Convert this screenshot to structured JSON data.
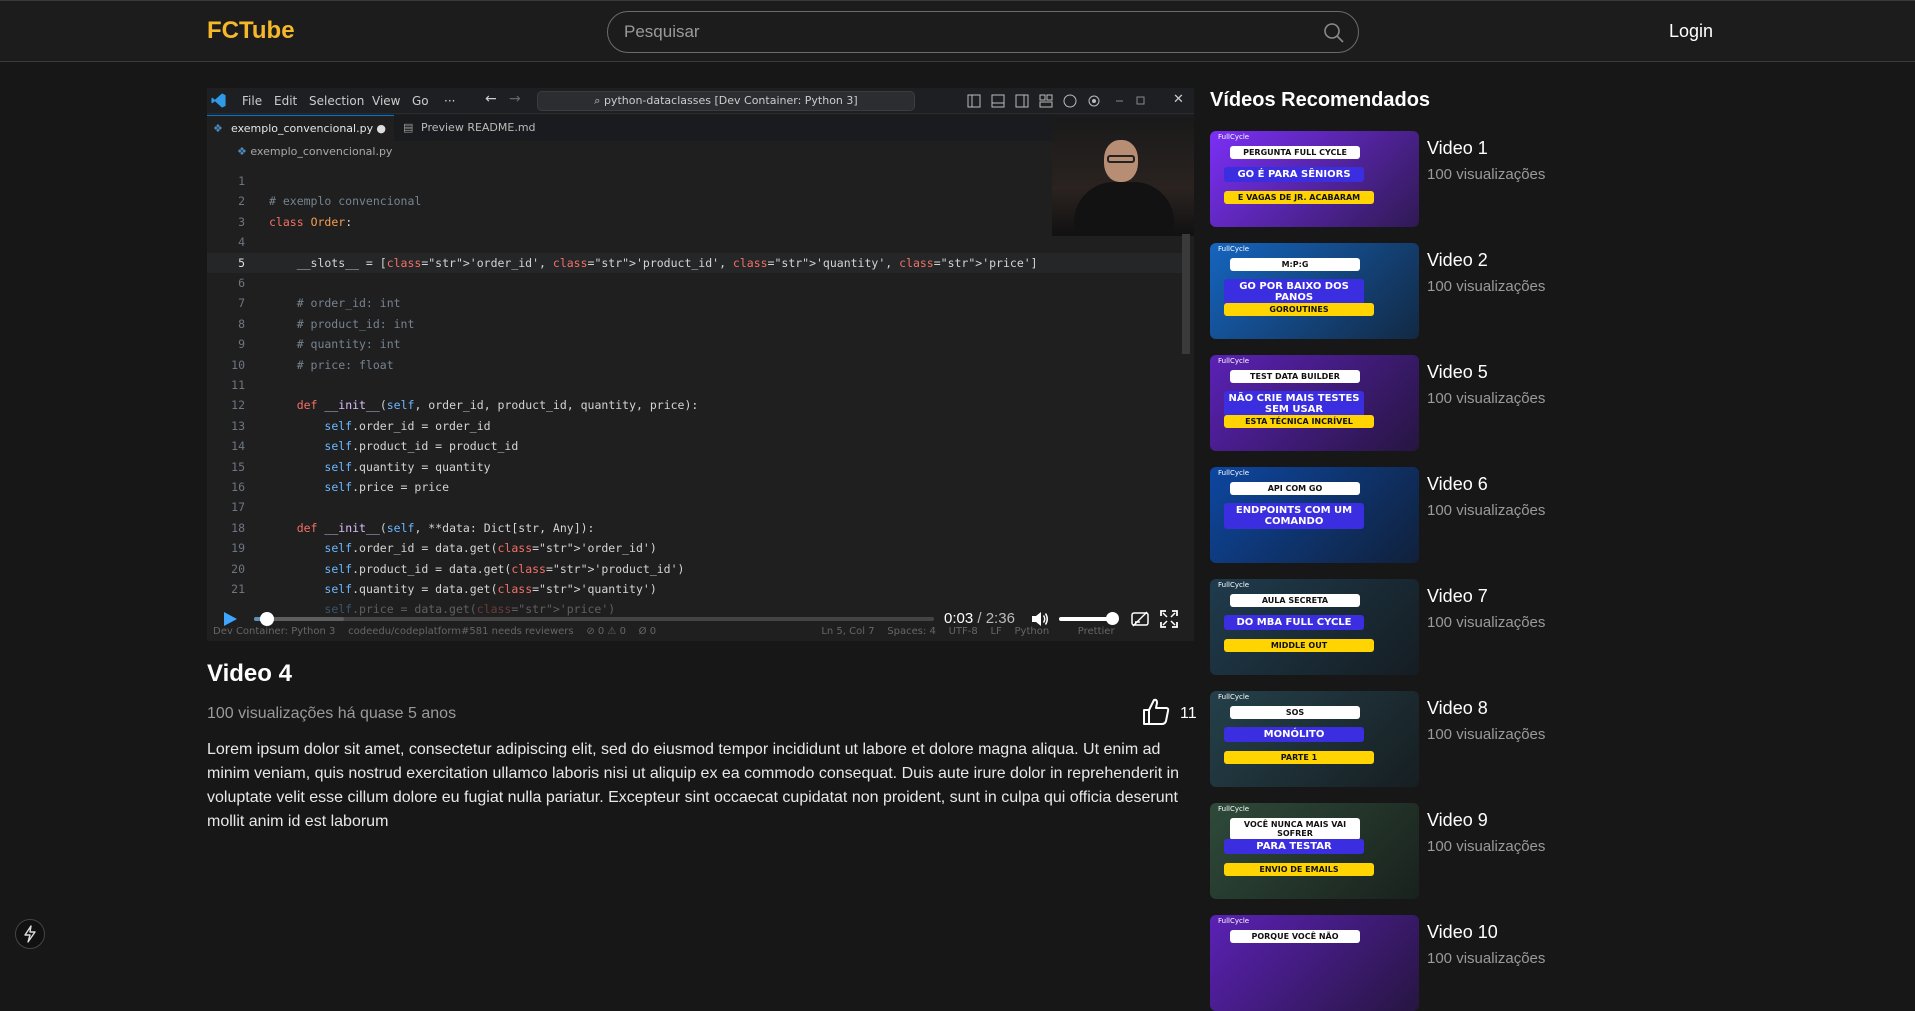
{
  "header": {
    "logo": "FCTube",
    "search_placeholder": "Pesquisar",
    "login_label": "Login",
    "accent_color": "#f5b72b"
  },
  "player": {
    "editor": {
      "menu": [
        "File",
        "Edit",
        "Selection",
        "View",
        "Go",
        "···"
      ],
      "command_center": "python-dataclasses [Dev Container: Python 3]",
      "tabs": [
        "exemplo_convencional.py",
        "Preview README.md"
      ],
      "breadcrumb": "exemplo_convencional.py",
      "status_bar": "Dev Container: Python 3    codeedu/codeplatform#581 needs reviewers    ⊘ 0 ⚠ 0    Ø 0                                                    Ln 5, Col 7    Spaces: 4    UTF-8    LF    Python         Prettier",
      "lines": [
        {
          "n": "1",
          "code": ""
        },
        {
          "n": "2",
          "code": "# exemplo convencional"
        },
        {
          "n": "3",
          "code": "class Order:"
        },
        {
          "n": "4",
          "code": ""
        },
        {
          "n": "5",
          "code": "    __slots__ = ['order_id', 'product_id', 'quantity', 'price']"
        },
        {
          "n": "6",
          "code": ""
        },
        {
          "n": "7",
          "code": "    # order_id: int"
        },
        {
          "n": "8",
          "code": "    # product_id: int"
        },
        {
          "n": "9",
          "code": "    # quantity: int"
        },
        {
          "n": "10",
          "code": "    # price: float"
        },
        {
          "n": "11",
          "code": ""
        },
        {
          "n": "12",
          "code": "    def __init__(self, order_id, product_id, quantity, price):"
        },
        {
          "n": "13",
          "code": "        self.order_id = order_id"
        },
        {
          "n": "14",
          "code": "        self.product_id = product_id"
        },
        {
          "n": "15",
          "code": "        self.quantity = quantity"
        },
        {
          "n": "16",
          "code": "        self.price = price"
        },
        {
          "n": "17",
          "code": ""
        },
        {
          "n": "18",
          "code": "    def __init__(self, **data: Dict[str, Any]):"
        },
        {
          "n": "19",
          "code": "        self.order_id = data.get('order_id')"
        },
        {
          "n": "20",
          "code": "        self.product_id = data.get('product_id')"
        },
        {
          "n": "21",
          "code": "        self.quantity = data.get('quantity')"
        },
        {
          "n": "",
          "code": "        self.price = data.get('price')"
        }
      ]
    },
    "current_time": "0:03",
    "duration": "2:36",
    "progress": 0.019,
    "volume": 1.0
  },
  "video": {
    "title": "Video 4",
    "meta": "100 visualizações há quase 5 anos",
    "likes": "11",
    "description": "Lorem ipsum dolor sit amet, consectetur adipiscing elit, sed do eiusmod tempor incididunt ut labore et dolore magna aliqua. Ut enim ad minim veniam, quis nostrud exercitation ullamco laboris nisi ut aliquip ex ea commodo consequat. Duis aute irure dolor in reprehenderit in voluptate velit esse cillum dolore eu fugiat nulla pariatur. Excepteur sint occaecat cupidatat non proident, sunt in culpa qui officia deserunt mollit anim id est laborum"
  },
  "recommended": {
    "heading": "Vídeos Recomendados",
    "items": [
      {
        "title": "Video 1",
        "views": "100 visualizações",
        "thumb_text": [
          "PERGUNTA FULL CYCLE",
          "GO É PARA SÊNIORS",
          "E VAGAS DE JR. ACABARAM"
        ],
        "bg": "#7b2ff7"
      },
      {
        "title": "Video 2",
        "views": "100 visualizações",
        "thumb_text": [
          "M:P:G",
          "GO POR BAIXO DOS PANOS",
          "GOROUTINES"
        ],
        "bg": "#1565c0"
      },
      {
        "title": "Video 5",
        "views": "100 visualizações",
        "thumb_text": [
          "TEST DATA BUILDER",
          "NÃO CRIE MAIS TESTES SEM USAR",
          "ESTA TÉCNICA INCRÍVEL"
        ],
        "bg": "#5b21b6"
      },
      {
        "title": "Video 6",
        "views": "100 visualizações",
        "thumb_text": [
          "API COM GO",
          "ENDPOINTS COM UM COMANDO",
          ""
        ],
        "bg": "#0d47a1"
      },
      {
        "title": "Video 7",
        "views": "100 visualizações",
        "thumb_text": [
          "AULA SECRETA",
          "DO MBA FULL CYCLE",
          "MIDDLE OUT"
        ],
        "bg": "#1f3b4d"
      },
      {
        "title": "Video 8",
        "views": "100 visualizações",
        "thumb_text": [
          "SOS",
          "MONÓLITO",
          "PARTE 1"
        ],
        "bg": "#24404a"
      },
      {
        "title": "Video 9",
        "views": "100 visualizações",
        "thumb_text": [
          "VOCÊ NUNCA MAIS VAI SOFRER",
          "PARA TESTAR",
          "ENVIO DE EMAILS"
        ],
        "bg": "#2e4a3a"
      },
      {
        "title": "Video 10",
        "views": "100 visualizações",
        "thumb_text": [
          "PORQUE VOCÊ NÃO",
          "",
          ""
        ],
        "bg": "#5b21b6"
      }
    ]
  }
}
